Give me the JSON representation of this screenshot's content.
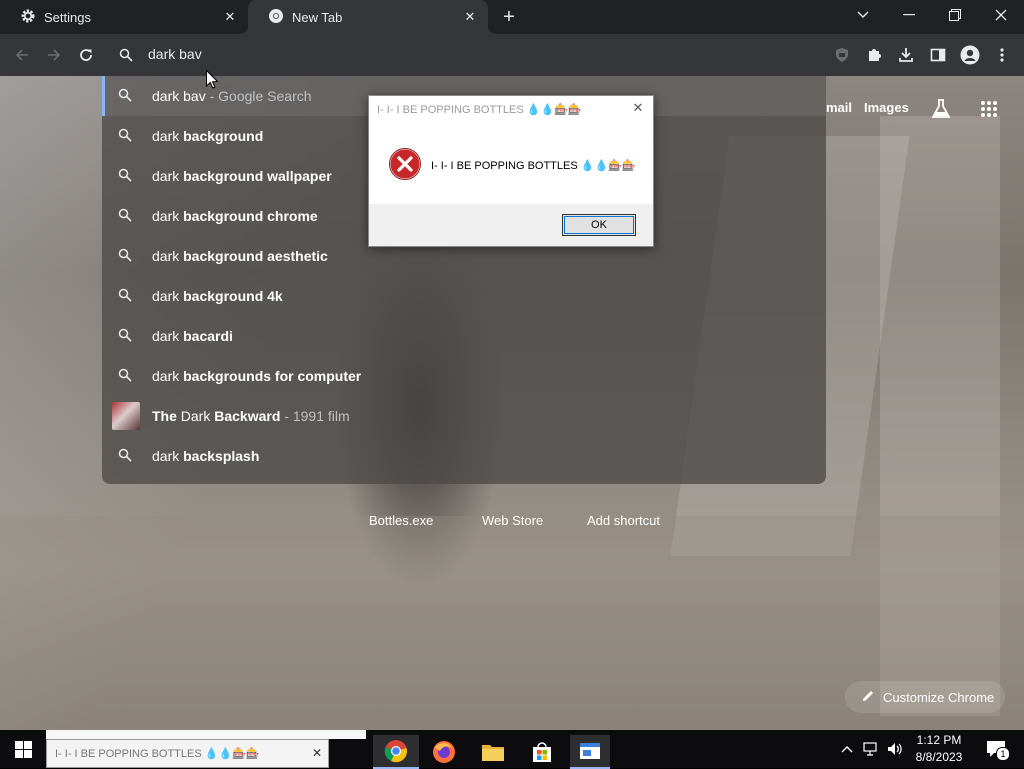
{
  "tabs": [
    {
      "title": "Settings",
      "icon": "gear-icon"
    },
    {
      "title": "New Tab",
      "icon": "chrome-icon",
      "active": true
    }
  ],
  "omnibox": {
    "query": "dark bav"
  },
  "suggestions": [
    {
      "normal": "dark bav",
      "bold": "",
      "desc": " - Google Search",
      "selected": true
    },
    {
      "normal": "dark ",
      "bold": "background",
      "desc": ""
    },
    {
      "normal": "dark ",
      "bold": "background wallpaper",
      "desc": ""
    },
    {
      "normal": "dark ",
      "bold": "background chrome",
      "desc": ""
    },
    {
      "normal": "dark ",
      "bold": "background aesthetic",
      "desc": ""
    },
    {
      "normal": "dark ",
      "bold": "background 4k",
      "desc": ""
    },
    {
      "normal": "dark ",
      "bold": "bacardi",
      "desc": ""
    },
    {
      "normal": "dark ",
      "bold": "backgrounds for computer",
      "desc": ""
    },
    {
      "normal": "The",
      "bold": " Dark ",
      "normal2": "Backward",
      "desc": " - 1991 film",
      "entity": true
    },
    {
      "normal": "dark ",
      "bold": "backsplash",
      "desc": ""
    }
  ],
  "ntp": {
    "header_links": [
      "mail",
      "Images"
    ],
    "shortcuts": [
      "Bottles.exe",
      "Web Store",
      "Add shortcut"
    ],
    "customize": "Customize Chrome"
  },
  "dialog": {
    "title": "I- I- I BE POPPING BOTTLES 💧💧🎰🎰",
    "message": "I- I- I BE POPPING BOTTLES 💧💧🎰🎰",
    "ok": "OK"
  },
  "taskbar": {
    "search_text": "I- I- I BE POPPING BOTTLES 💧💧🎰🎰",
    "time": "1:12 PM",
    "date": "8/8/2023",
    "notification_count": "1"
  },
  "colors": {
    "accent": "#8ab4f8",
    "toolbar": "#35363a",
    "tabstrip": "#202124"
  }
}
